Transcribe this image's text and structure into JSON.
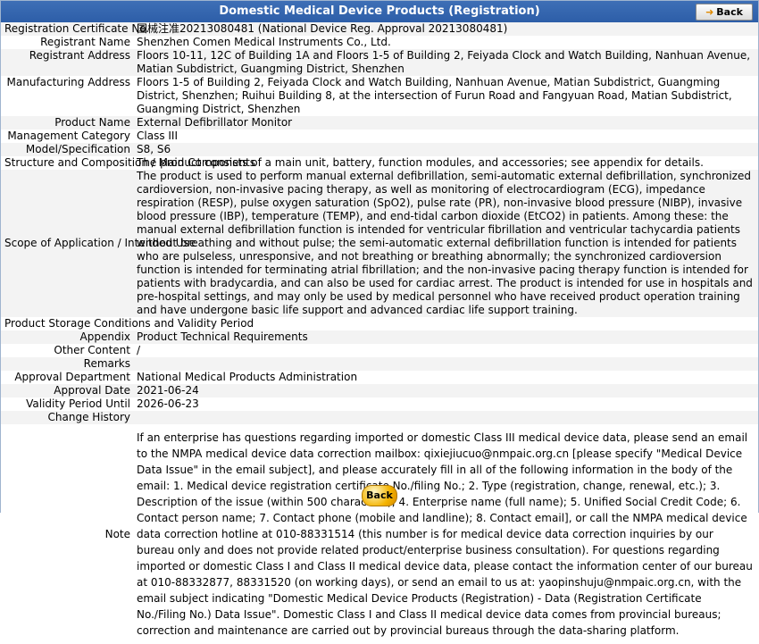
{
  "header": {
    "title": "Domestic Medical Device Products (Registration)",
    "back_label": "Back"
  },
  "rows": [
    {
      "label": "Registration Certificate No.",
      "value": "国械注准20213080481 (National Device Reg. Approval 20213080481)"
    },
    {
      "label": "Registrant Name",
      "value": "Shenzhen Comen Medical Instruments Co., Ltd."
    },
    {
      "label": "Registrant Address",
      "value": "Floors 10-11, 12C of Building 1A and Floors 1-5 of Building 2, Feiyada Clock and Watch Building, Nanhuan Avenue, Matian Subdistrict, Guangming District, Shenzhen"
    },
    {
      "label": "Manufacturing Address",
      "value": "Floors 1-5 of Building 2, Feiyada Clock and Watch Building, Nanhuan Avenue, Matian Subdistrict, Guangming District, Shenzhen; Ruihui Building 8, at the intersection of Furun Road and Fangyuan Road, Matian Subdistrict, Guangming District, Shenzhen"
    },
    {
      "label": "Product Name",
      "value": "External Defibrillator Monitor"
    },
    {
      "label": "Management Category",
      "value": "Class III"
    },
    {
      "label": "Model/Specification",
      "value": "S8, S6"
    },
    {
      "label": "Structure and Composition / Main Components",
      "value": "The product consists of a main unit, battery, function modules, and accessories; see appendix for details."
    },
    {
      "label": "Scope of Application / Intended Use",
      "value": "The product is used to perform manual external defibrillation, semi-automatic external defibrillation, synchronized cardioversion, non-invasive pacing therapy, as well as monitoring of electrocardiogram (ECG), impedance respiration (RESP), pulse oxygen saturation (SpO2), pulse rate (PR), non-invasive blood pressure (NIBP), invasive blood pressure (IBP), temperature (TEMP), and end-tidal carbon dioxide (EtCO2) in patients. Among these: the manual external defibrillation function is intended for ventricular fibrillation and ventricular tachycardia patients without breathing and without pulse; the semi-automatic external defibrillation function is intended for patients who are pulseless, unresponsive, and not breathing or breathing abnormally; the synchronized cardioversion function is intended for terminating atrial fibrillation; and the non-invasive pacing therapy function is intended for patients with bradycardia, and can also be used for cardiac arrest. The product is intended for use in hospitals and pre-hospital settings, and may only be used by medical personnel who have received product operation training and have undergone basic life support and advanced cardiac life support training."
    },
    {
      "label": "Product Storage Conditions and Validity Period",
      "value": ""
    },
    {
      "label": "Appendix",
      "value": "Product Technical Requirements"
    },
    {
      "label": "Other Content",
      "value": "/"
    },
    {
      "label": "Remarks",
      "value": ""
    },
    {
      "label": "Approval Department",
      "value": "National Medical Products Administration"
    },
    {
      "label": "Approval Date",
      "value": "2021-06-24"
    },
    {
      "label": "Validity Period Until",
      "value": "2026-06-23"
    },
    {
      "label": "Change History",
      "value": ""
    }
  ],
  "note": {
    "label": "Note",
    "text": "If an enterprise has questions regarding imported or domestic Class III medical device data, please send an email to the NMPA medical device data correction mailbox: qixiejiucuo@nmpaic.org.cn [please specify \"Medical Device Data Issue\" in the email subject], and please accurately fill in all of the following information in the body of the email: 1. Medical device registration certificate No./filing No.; 2. Type (registration, change, renewal, etc.); 3. Description of the issue (within 500 characters); 4. Enterprise name (full name); 5. Unified Social Credit Code; 6. Contact person name; 7. Contact phone (mobile and landline); 8. Contact email], or call the NMPA medical device data correction hotline at 010-88331514 (this number is for medical device data correction inquiries by our bureau only and does not provide related product/enterprise business consultation). For questions regarding imported or domestic Class I and Class II medical device data, please contact the information center of our bureau at 010-88332877, 88331520 (on working days), or send an email to us at: yaopinshuju@nmpaic.org.cn, with the email subject indicating \"Domestic Medical Device Products (Registration) - Data (Registration Certificate No./Filing No.) Data Issue\". Domestic Class I and Class II medical device data comes from provincial bureaus; correction and maintenance are carried out by provincial bureaus through the data-sharing platform."
  },
  "footer": {
    "back_label": "Back"
  }
}
